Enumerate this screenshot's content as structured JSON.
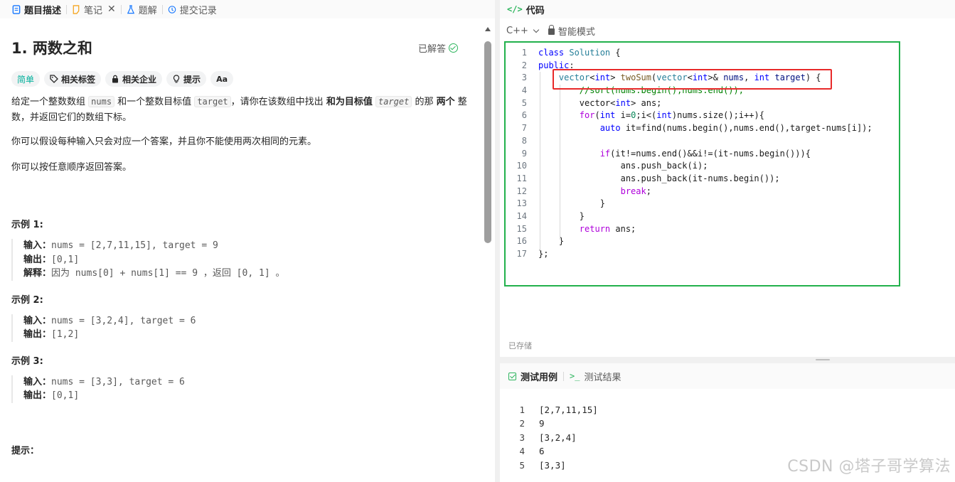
{
  "left_tabs": [
    {
      "label": "题目描述",
      "icon": "document-icon",
      "active": true
    },
    {
      "label": "笔记",
      "icon": "note-icon",
      "closable": true
    },
    {
      "label": "题解",
      "icon": "flask-icon"
    },
    {
      "label": "提交记录",
      "icon": "history-icon"
    }
  ],
  "problem": {
    "title": "1. 两数之和",
    "status": "已解答",
    "tags": {
      "difficulty": "简单",
      "related_tags": "相关标签",
      "related_companies": "相关企业",
      "hint": "提示",
      "font_size": "Aa"
    },
    "desc1": {
      "p1": "给定一个整数数组 ",
      "c1": "nums",
      "p2": " 和一个整数目标值 ",
      "c2": "target",
      "p3": "，请你在该数组中找出 ",
      "b1": "和为目标值",
      "c3": "target",
      "p4": " 的那 ",
      "b2": "两个",
      "p5": " 整数，并返回它们的数组下标。"
    },
    "desc2": "你可以假设每种输入只会对应一个答案，并且你不能使用两次相同的元素。",
    "desc3": "你可以按任意顺序返回答案。",
    "examples": [
      {
        "title": "示例 1:",
        "input_label": "输入：",
        "input": "nums = [2,7,11,15], target = 9",
        "output_label": "输出：",
        "output": "[0,1]",
        "explain_label": "解释：",
        "explain": "因为 nums[0] + nums[1] == 9 ，返回 [0, 1] 。"
      },
      {
        "title": "示例 2:",
        "input_label": "输入：",
        "input": "nums = [3,2,4], target = 6",
        "output_label": "输出：",
        "output": "[1,2]"
      },
      {
        "title": "示例 3:",
        "input_label": "输入：",
        "input": "nums = [3,3], target = 6",
        "output_label": "输出：",
        "output": "[0,1]"
      }
    ],
    "hints_title": "提示："
  },
  "code_panel": {
    "title": "代码",
    "language": "C++",
    "mode": "智能模式",
    "saved": "已存储",
    "line_numbers": [
      "1",
      "2",
      "3",
      "4",
      "5",
      "6",
      "7",
      "8",
      "9",
      "10",
      "11",
      "12",
      "13",
      "14",
      "15",
      "16",
      "17"
    ]
  },
  "test_panel": {
    "tab_testcase": "测试用例",
    "tab_result": "测试结果",
    "lines": [
      {
        "n": "1",
        "v": "[2,7,11,15]"
      },
      {
        "n": "2",
        "v": "9"
      },
      {
        "n": "3",
        "v": "[3,2,4]"
      },
      {
        "n": "4",
        "v": "6"
      },
      {
        "n": "5",
        "v": "[3,3]"
      }
    ]
  },
  "watermark": "CSDN @塔子哥学算法",
  "colors": {
    "accent_green": "#2db55d",
    "easy_teal": "#00af9b",
    "highlight_red": "#e82a2a",
    "highlight_green": "#22b14c"
  }
}
